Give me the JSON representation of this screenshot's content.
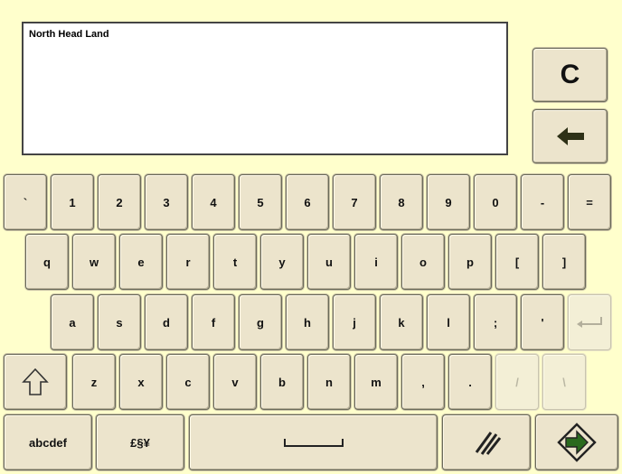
{
  "text_field": {
    "value": "North Head Land"
  },
  "side_buttons": {
    "clear_label": "C"
  },
  "row1": [
    "`",
    "1",
    "2",
    "3",
    "4",
    "5",
    "6",
    "7",
    "8",
    "9",
    "0",
    "-",
    "="
  ],
  "row2": [
    "q",
    "w",
    "e",
    "r",
    "t",
    "y",
    "u",
    "i",
    "o",
    "p",
    "[",
    "]"
  ],
  "row3": [
    "a",
    "s",
    "d",
    "f",
    "g",
    "h",
    "j",
    "k",
    "l",
    ";",
    "'"
  ],
  "row4": [
    "z",
    "x",
    "c",
    "v",
    "b",
    "n",
    "m",
    ",",
    ".",
    "/",
    "\\"
  ],
  "row5": {
    "abc_label": "abcdef",
    "symbols_label": "£§¥"
  },
  "icons": {
    "backspace": "left-arrow-icon",
    "enter": "enter-icon",
    "shift": "shift-up-arrow-icon",
    "space": "space-bar-icon",
    "slashes": "double-slash-icon",
    "accept": "accept-arrow-icon"
  },
  "disabled_keys": [
    "enter",
    "/",
    "\\"
  ]
}
